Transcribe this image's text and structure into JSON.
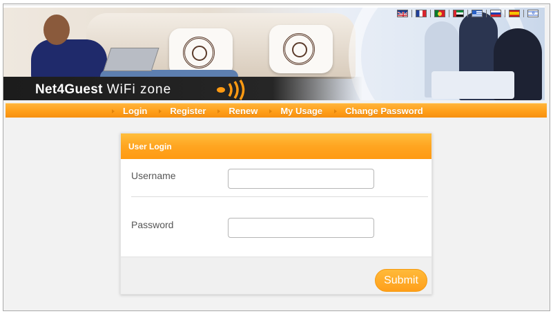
{
  "header": {
    "brand_bold": "Net4Guest",
    "brand_rest": "WiFi zone",
    "languages": [
      "english-flag",
      "french-flag",
      "portuguese-flag",
      "arabic-flag",
      "greek-flag",
      "russian-flag",
      "spanish-flag",
      "israeli-flag"
    ]
  },
  "nav": {
    "items": [
      "Login",
      "Register",
      "Renew",
      "My Usage",
      "Change Password"
    ]
  },
  "login": {
    "title": "User Login",
    "username_label": "Username",
    "username_value": "",
    "password_label": "Password",
    "password_value": "",
    "submit_label": "Submit"
  },
  "colors": {
    "accent": "#ff9f1a",
    "background": "#f2f2f2"
  }
}
